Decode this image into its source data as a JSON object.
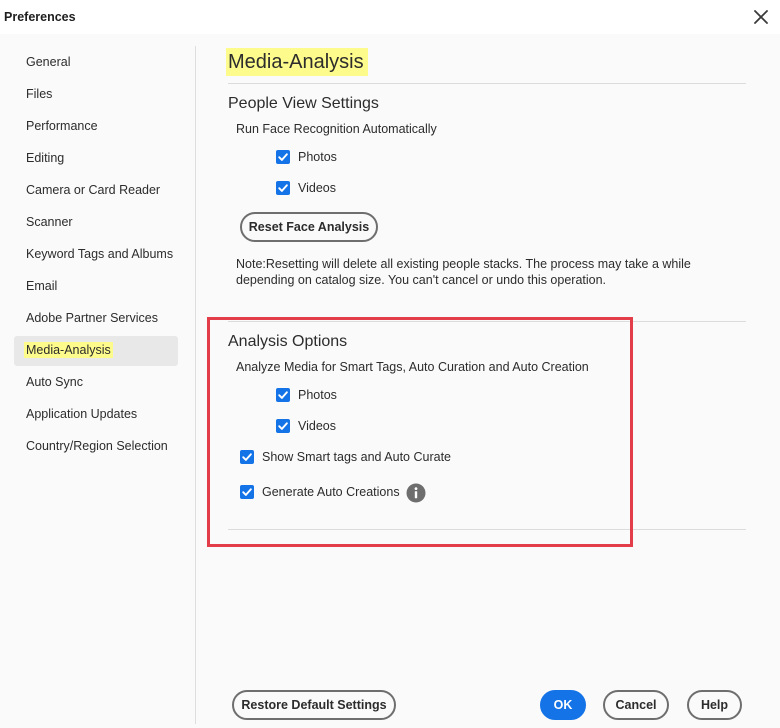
{
  "window": {
    "title": "Preferences"
  },
  "sidebar": {
    "items": [
      {
        "label": "General"
      },
      {
        "label": "Files"
      },
      {
        "label": "Performance"
      },
      {
        "label": "Editing"
      },
      {
        "label": "Camera or Card Reader"
      },
      {
        "label": "Scanner"
      },
      {
        "label": "Keyword Tags and Albums"
      },
      {
        "label": "Email"
      },
      {
        "label": "Adobe Partner Services"
      },
      {
        "label": "Media-Analysis",
        "selected": true
      },
      {
        "label": "Auto Sync"
      },
      {
        "label": "Application Updates"
      },
      {
        "label": "Country/Region Selection"
      }
    ]
  },
  "main": {
    "page_title": "Media-Analysis",
    "people_view": {
      "title": "People View Settings",
      "subtitle": "Run Face Recognition Automatically",
      "photos_label": "Photos",
      "photos_checked": true,
      "videos_label": "Videos",
      "videos_checked": true,
      "reset_button": "Reset Face Analysis",
      "note": "Note:Resetting will delete all existing people stacks. The process may take a while depending on catalog size. You can't cancel or undo this operation."
    },
    "analysis_options": {
      "title": "Analysis Options",
      "subtitle": "Analyze Media for Smart Tags, Auto Curation and Auto Creation",
      "photos_label": "Photos",
      "photos_checked": true,
      "videos_label": "Videos",
      "videos_checked": true,
      "smart_tags_label": "Show Smart tags and Auto Curate",
      "smart_tags_checked": true,
      "auto_creations_label": "Generate Auto Creations",
      "auto_creations_checked": true
    }
  },
  "footer": {
    "restore_label": "Restore Default Settings",
    "ok_label": "OK",
    "cancel_label": "Cancel",
    "help_label": "Help"
  },
  "icons": {
    "close": "close-icon",
    "checkbox": "checkmark-icon",
    "info": "info-icon"
  },
  "colors": {
    "accent": "#1473e6",
    "highlight": "#fdfb8c",
    "annotation_box": "#e23d48",
    "selected_row": "#e8e8e8"
  }
}
